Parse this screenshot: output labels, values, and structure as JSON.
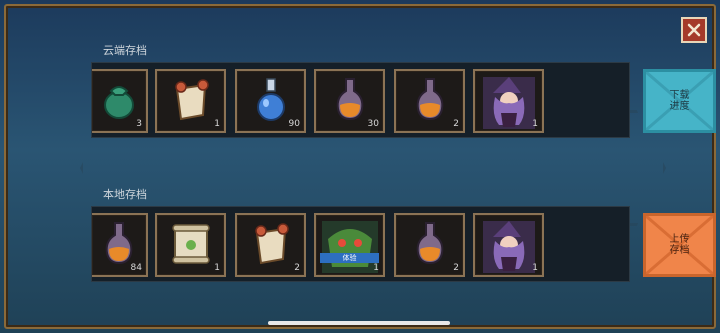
{
  "close": {
    "icon": "close-icon"
  },
  "cloud": {
    "label": "云端存档",
    "items": [
      {
        "icon": "green-pouch-icon",
        "count": "3"
      },
      {
        "icon": "scroll-bundle-icon",
        "count": "1"
      },
      {
        "icon": "blue-potion-icon",
        "count": "90"
      },
      {
        "icon": "orange-potion-icon",
        "count": "30"
      },
      {
        "icon": "orange-potion-icon",
        "count": "2"
      },
      {
        "icon": "witch-character-icon",
        "count": "1"
      }
    ],
    "action_label": "下载进度"
  },
  "local": {
    "label": "本地存档",
    "items": [
      {
        "icon": "orange-potion-icon",
        "count": "84"
      },
      {
        "icon": "map-scroll-icon",
        "count": "1"
      },
      {
        "icon": "scroll-bundle-icon",
        "count": "2"
      },
      {
        "icon": "monster-character-icon",
        "count": "1",
        "tag": "体验"
      },
      {
        "icon": "orange-potion-icon",
        "count": "2"
      },
      {
        "icon": "witch-character-icon",
        "count": "1"
      }
    ],
    "action_label": "上传存档"
  },
  "colors": {
    "download": "#46b4c8",
    "upload": "#f0854a",
    "close": "#a53a2a"
  }
}
